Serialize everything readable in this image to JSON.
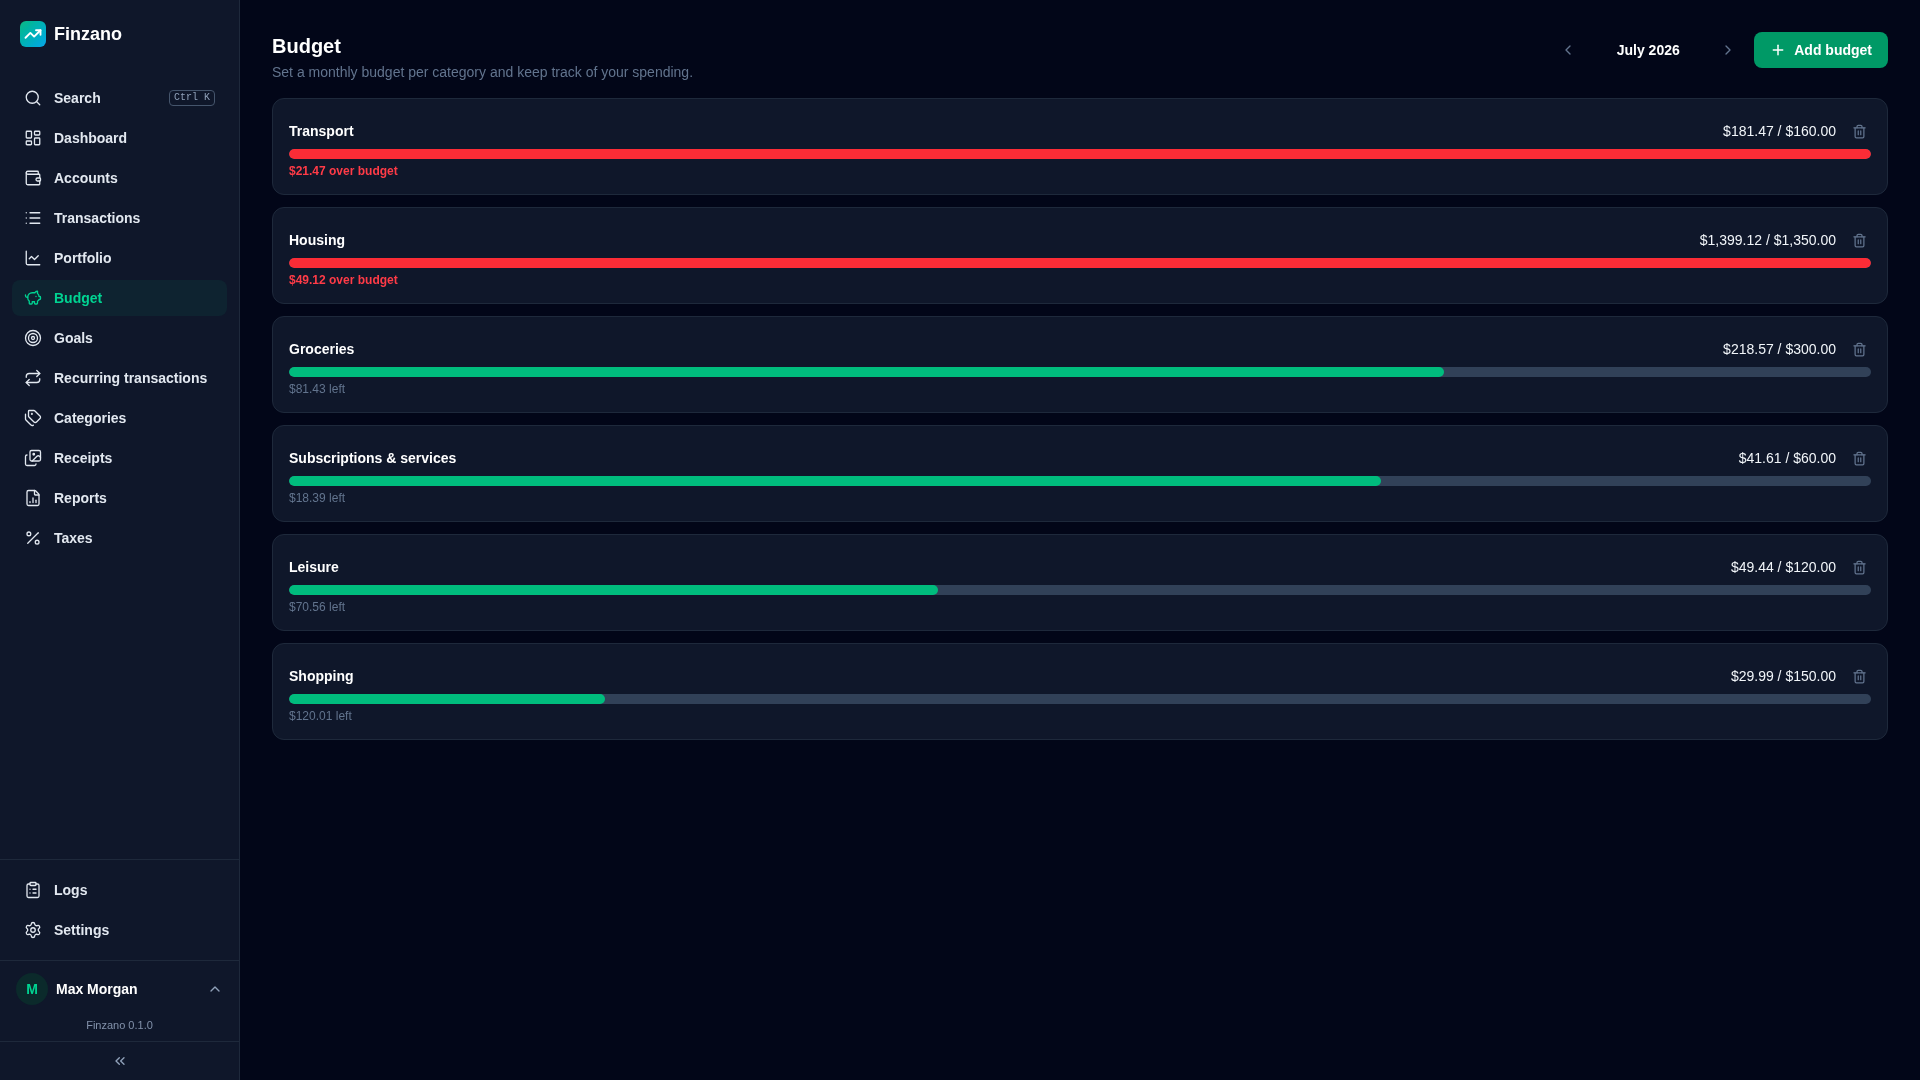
{
  "app": {
    "name": "Finzano"
  },
  "sidebar": {
    "search": {
      "label": "Search",
      "shortcut": "Ctrl K"
    },
    "nav_items": [
      {
        "label": "Dashboard",
        "selected": false
      },
      {
        "label": "Accounts",
        "selected": false
      },
      {
        "label": "Transactions",
        "selected": false
      },
      {
        "label": "Portfolio",
        "selected": false
      },
      {
        "label": "Budget",
        "selected": true
      },
      {
        "label": "Goals",
        "selected": false
      },
      {
        "label": "Recurring transactions",
        "selected": false
      },
      {
        "label": "Categories",
        "selected": false
      },
      {
        "label": "Receipts",
        "selected": false
      },
      {
        "label": "Reports",
        "selected": false
      },
      {
        "label": "Taxes",
        "selected": false
      }
    ],
    "bottom_items": [
      {
        "label": "Logs",
        "selected": false
      },
      {
        "label": "Settings",
        "selected": false
      }
    ],
    "user": {
      "initial": "M",
      "name": "Max Morgan"
    },
    "version": "Finzano 0.1.0"
  },
  "header": {
    "title": "Budget",
    "subtitle": "Set a monthly budget per category and keep track of your spending.",
    "period": "July 2026",
    "add_button": "Add budget"
  },
  "budgets": [
    {
      "category": "Transport",
      "amount": "$181.47 / $160.00",
      "level": 1,
      "over_budget": true,
      "status": "$21.47 over budget"
    },
    {
      "category": "Housing",
      "amount": "$1,399.12 / $1,350.00",
      "level": 1,
      "over_budget": true,
      "status": "$49.12 over budget"
    },
    {
      "category": "Groceries",
      "amount": "$218.57 / $300.00",
      "level": 0.73,
      "over_budget": false,
      "status": "$81.43 left"
    },
    {
      "category": "Subscriptions & services",
      "amount": "$41.61 / $60.00",
      "level": 0.69,
      "over_budget": false,
      "status": "$18.39 left"
    },
    {
      "category": "Leisure",
      "amount": "$49.44 / $120.00",
      "level": 0.41,
      "over_budget": false,
      "status": "$70.56 left"
    },
    {
      "category": "Shopping",
      "amount": "$29.99 / $150.00",
      "level": 0.2,
      "over_budget": false,
      "status": "$120.01 left"
    }
  ]
}
